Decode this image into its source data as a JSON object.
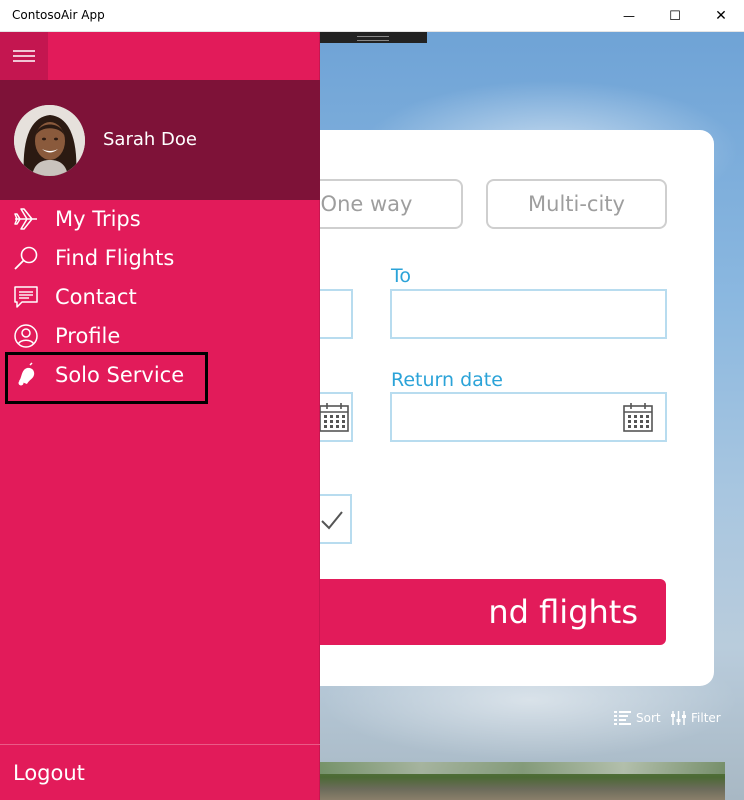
{
  "window": {
    "title": "ContosoAir App",
    "minimize_glyph": "—",
    "maximize_glyph": "☐",
    "close_glyph": "✕"
  },
  "booking": {
    "one_way_label": "One way",
    "multi_city_label": "Multi-city",
    "to_label": "To",
    "return_date_label": "Return date",
    "find_flights_label": "nd flights"
  },
  "list_tools": {
    "sort_label": "Sort",
    "filter_label": "Filter"
  },
  "drawer": {
    "user_name": "Sarah Doe",
    "items": [
      {
        "label": "My Trips",
        "icon": "airplane-icon"
      },
      {
        "label": "Find Flights",
        "icon": "search-icon"
      },
      {
        "label": "Contact",
        "icon": "chat-icon"
      },
      {
        "label": "Profile",
        "icon": "profile-icon"
      },
      {
        "label": "Solo Service",
        "icon": "bell-icon"
      }
    ],
    "logout_label": "Logout"
  },
  "colors": {
    "accent": "#e21b5a",
    "profile_band": "#7e1238",
    "field_label": "#2ba3d8"
  }
}
